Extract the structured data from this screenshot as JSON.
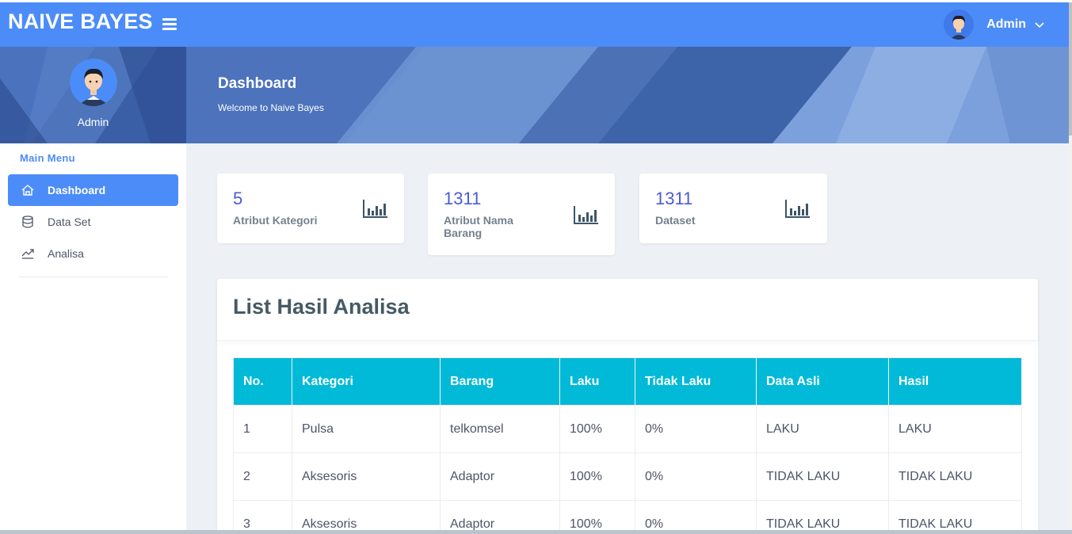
{
  "brand": "NAIVE BAYES",
  "navbar": {
    "user_name": "Admin"
  },
  "sidebar": {
    "user_name": "Admin",
    "menu_title": "Main Menu",
    "items": [
      {
        "label": "Dashboard",
        "icon": "home-icon",
        "active": true
      },
      {
        "label": "Data Set",
        "icon": "database-icon",
        "active": false
      },
      {
        "label": "Analisa",
        "icon": "trend-chart-icon",
        "active": false
      }
    ]
  },
  "page_header": {
    "title": "Dashboard",
    "subtitle": "Welcome to Naive Bayes"
  },
  "stats": [
    {
      "value": "5",
      "label": "Atribut Kategori",
      "icon": "bar-chart-icon"
    },
    {
      "value": "1311",
      "label": "Atribut Nama Barang",
      "icon": "bar-chart-icon"
    },
    {
      "value": "1311",
      "label": "Dataset",
      "icon": "bar-chart-icon"
    }
  ],
  "analysis": {
    "title": "List Hasil Analisa",
    "columns": [
      "No.",
      "Kategori",
      "Barang",
      "Laku",
      "Tidak Laku",
      "Data Asli",
      "Hasil"
    ],
    "rows": [
      [
        "1",
        "Pulsa",
        "telkomsel",
        "100%",
        "0%",
        "LAKU",
        "LAKU"
      ],
      [
        "2",
        "Aksesoris",
        "Adaptor",
        "100%",
        "0%",
        "TIDAK LAKU",
        "TIDAK LAKU"
      ],
      [
        "3",
        "Aksesoris",
        "Adaptor",
        "100%",
        "0%",
        "TIDAK LAKU",
        "TIDAK LAKU"
      ]
    ]
  },
  "colors": {
    "primary": "#4c8cf8",
    "table_header": "#00bad8",
    "stat_value": "#4c5bd4",
    "page_bg": "#edf1f5"
  }
}
